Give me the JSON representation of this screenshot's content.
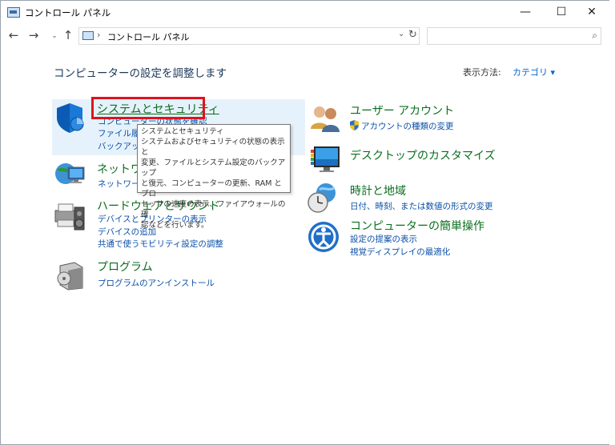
{
  "window": {
    "title": "コントロール パネル",
    "min_glyph": "—",
    "max_glyph": "☐",
    "close_glyph": "✕"
  },
  "nav": {
    "back_glyph": "←",
    "forward_glyph": "→",
    "recent_glyph": "⌄",
    "up_glyph": "↑",
    "breadcrumb_sep": "›",
    "breadcrumb": "コントロール パネル",
    "dropdown_glyph": "⌄",
    "refresh_glyph": "↻",
    "search_placeholder": "",
    "search_glyph": "⌕"
  },
  "header": {
    "heading": "コンピューターの設定を調整します",
    "view_by_label": "表示方法:",
    "view_by_value": "カテゴリ ▾"
  },
  "categories": {
    "system_security": {
      "title": "システムとセキュリティ",
      "links": [
        "コンピューターの状態を確認",
        "ファイル履歴",
        "バックアップ"
      ]
    },
    "network": {
      "title": "ネットワーク",
      "links": [
        "ネットワークの"
      ]
    },
    "hardware": {
      "title": "ハードウェアとサウンド",
      "links": [
        "デバイスとプリンターの表示",
        "デバイスの追加",
        "共通で使うモビリティ設定の調整"
      ]
    },
    "programs": {
      "title": "プログラム",
      "links": [
        "プログラムのアンインストール"
      ]
    },
    "user_accounts": {
      "title": "ユーザー アカウント",
      "links": [
        "アカウントの種類の変更"
      ]
    },
    "desktop": {
      "title": "デスクトップのカスタマイズ",
      "links": []
    },
    "clock_region": {
      "title": "時計と地域",
      "links": [
        "日付、時刻、または数値の形式の変更"
      ]
    },
    "ease_access": {
      "title": "コンピューターの簡単操作",
      "links": [
        "設定の提案の表示",
        "視覚ディスプレイの最適化"
      ]
    }
  },
  "tooltip": {
    "title": "システムとセキュリティ",
    "lines": [
      "システムおよびセキュリティの状態の表示と",
      "変更、ファイルとシステム設定のバックアップ",
      "と復元、コンピューターの更新、RAM とプロ",
      "セッサの速度の表示、ファイアウォールの確",
      "認などを行います。"
    ]
  },
  "colors": {
    "category_title": "#0a6e1e",
    "link": "#0a50a8",
    "highlight_box": "#e0121f",
    "hover_bg": "#e6f2fb",
    "heading": "#1e395b"
  }
}
